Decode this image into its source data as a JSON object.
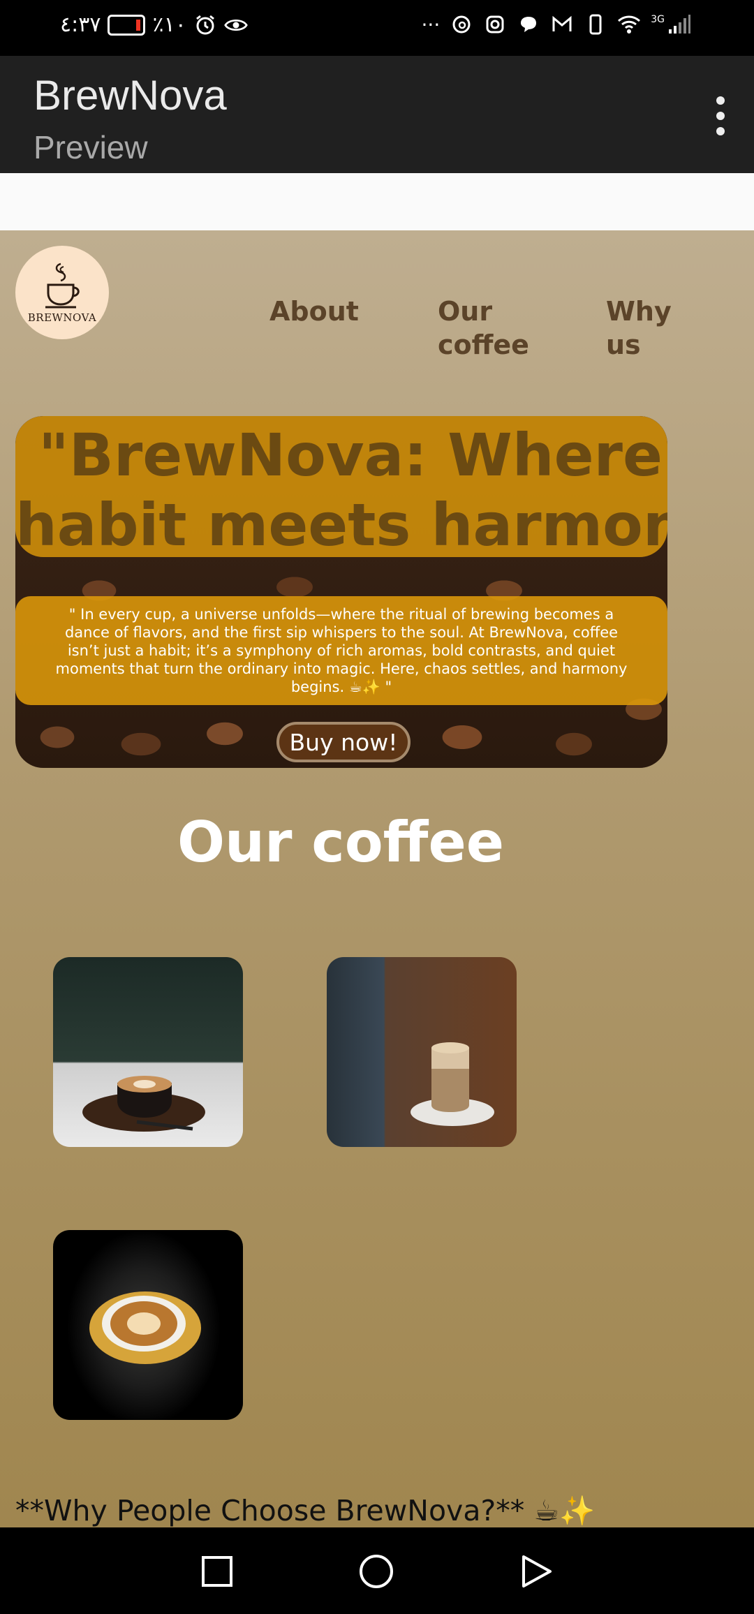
{
  "status_bar": {
    "time": "٤:٣٧",
    "battery": "٪١٠",
    "network": "3G",
    "icons": [
      "battery-icon",
      "alarm-icon",
      "eye-icon",
      "more-dots-icon",
      "threads-icon",
      "instagram-icon",
      "chat-icon",
      "gmail-icon",
      "phone-icon",
      "wifi-icon",
      "signal-icon"
    ]
  },
  "app_bar": {
    "title": "BrewNova",
    "subtitle": "Preview"
  },
  "site": {
    "logo_text": "BREWNOVA",
    "nav": [
      {
        "label": "About"
      },
      {
        "label": "Our coffee"
      },
      {
        "label": "Why us"
      }
    ],
    "hero": {
      "title": "\"BrewNova: Where habit meets harmony.\"",
      "title_line1": "\"BrewNova: Where",
      "title_line2": "habit meets harmony.\"",
      "quote": "\" In every cup, a universe unfolds—where the ritual of brewing becomes a dance of flavors, and the first sip whispers to the soul. At BrewNova, coffee isn’t just a habit; it’s a symphony of rich aromas, bold contrasts, and quiet moments that turn the ordinary into magic. Here, chaos settles, and harmony begins. ☕✨ \"",
      "button": "Buy now!"
    },
    "coffee_section": {
      "title": "Our coffee"
    },
    "why_heading": "**Why People Choose BrewNova?** ☕✨"
  },
  "colors": {
    "accent": "#de9a0a",
    "title_brown": "#6b4a12",
    "button_brown": "#5c3414"
  }
}
